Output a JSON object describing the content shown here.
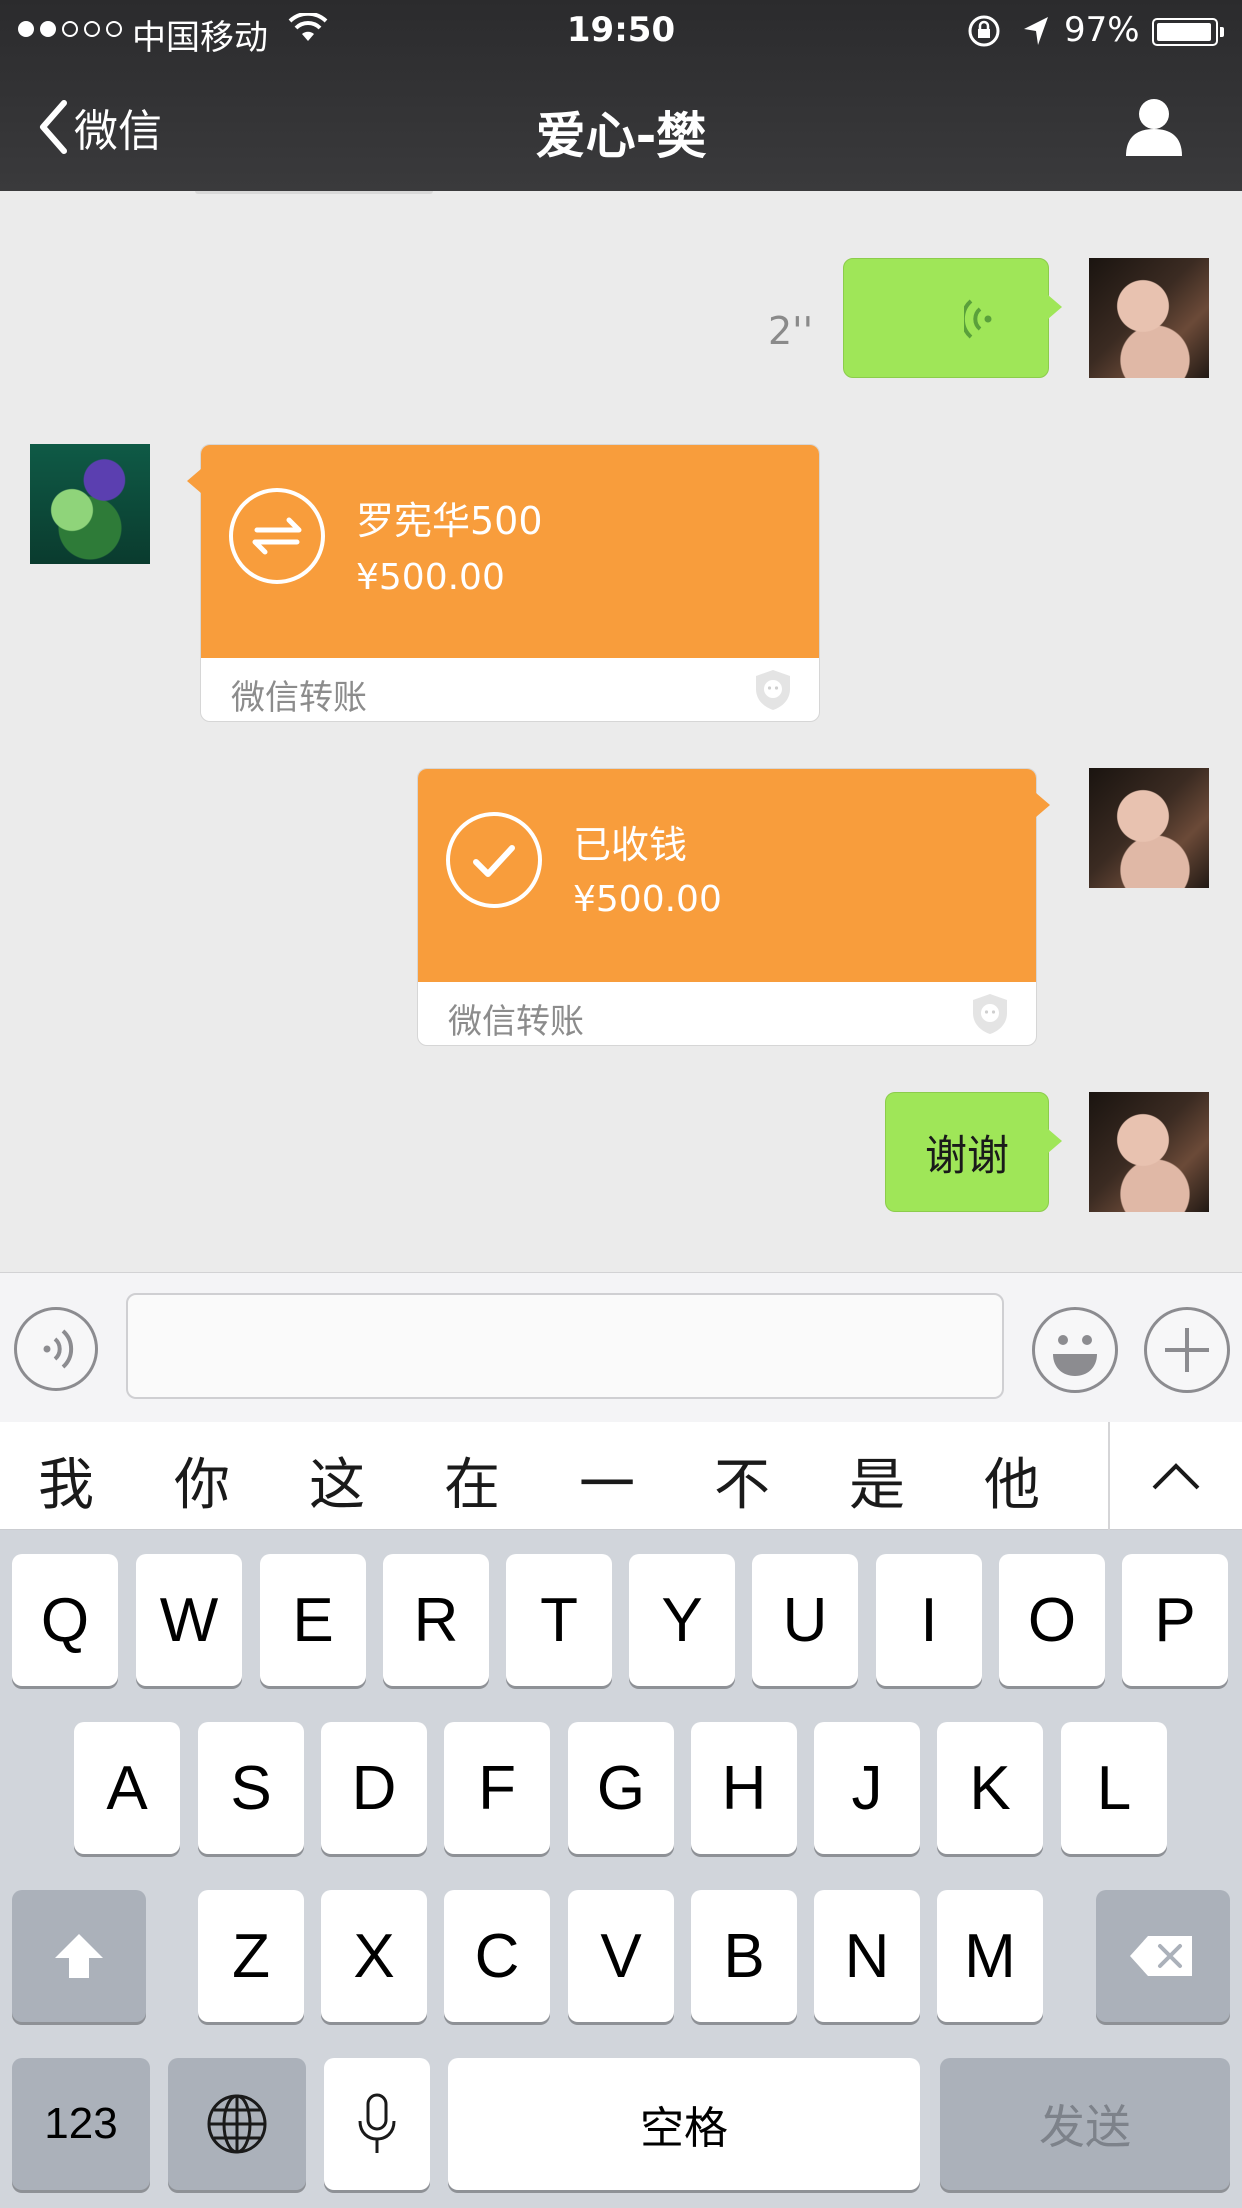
{
  "status_bar": {
    "carrier": "中国移动",
    "time": "19:50",
    "battery_percent": "97%",
    "battery_level": 0.97,
    "signal_bars_filled": 2,
    "signal_bars_total": 5
  },
  "nav": {
    "back_label": "微信",
    "title": "爱心-樊"
  },
  "messages": [
    {
      "side": "right",
      "type": "voice",
      "duration": "2''"
    },
    {
      "side": "left",
      "type": "transfer",
      "title": "罗宪华500",
      "amount": "¥500.00",
      "label": "微信转账"
    },
    {
      "side": "right",
      "type": "transfer",
      "title": "已收钱",
      "amount": "¥500.00",
      "label": "微信转账"
    },
    {
      "side": "right",
      "type": "text",
      "text": "谢谢"
    }
  ],
  "input": {
    "value": "",
    "placeholder": ""
  },
  "candidates": [
    "我",
    "你",
    "这",
    "在",
    "一",
    "不",
    "是",
    "他"
  ],
  "keyboard": {
    "row1": [
      "Q",
      "W",
      "E",
      "R",
      "T",
      "Y",
      "U",
      "I",
      "O",
      "P"
    ],
    "row2": [
      "A",
      "S",
      "D",
      "F",
      "G",
      "H",
      "J",
      "K",
      "L"
    ],
    "row3": [
      "Z",
      "X",
      "C",
      "V",
      "B",
      "N",
      "M"
    ],
    "numbers_label": "123",
    "space_label": "空格",
    "send_label": "发送"
  },
  "colors": {
    "nav_bg": "#2b2b2d",
    "chat_bg": "#ebebeb",
    "bubble_green": "#9fe658",
    "transfer_orange": "#f89d3c",
    "keyboard_bg": "#d1d5db"
  },
  "icons": {
    "back": "chevron-left-icon",
    "profile": "person-icon",
    "voice_toggle": "voice-icon",
    "emoji": "smiley-icon",
    "more": "plus-icon",
    "transfer": "transfer-arrows-icon",
    "received": "check-icon",
    "shift": "shift-arrow-icon",
    "delete": "backspace-icon",
    "globe": "globe-icon",
    "mic": "microphone-icon"
  }
}
